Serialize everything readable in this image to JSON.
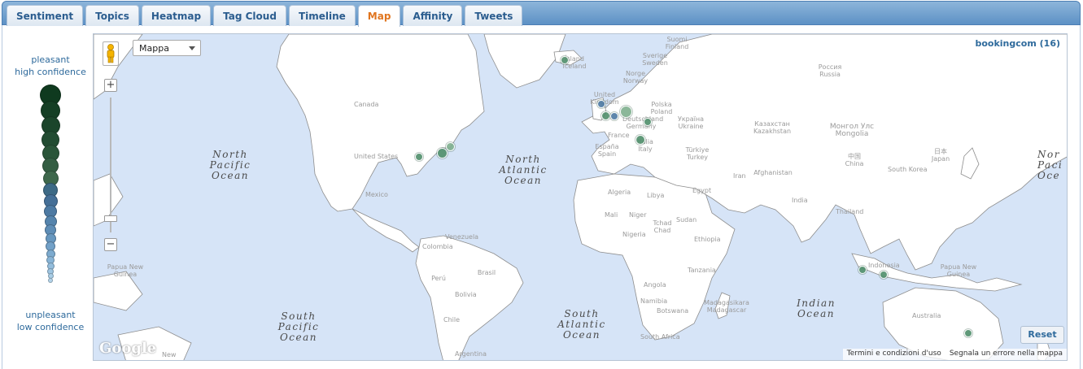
{
  "tabs": [
    {
      "label": "Sentiment",
      "active": false
    },
    {
      "label": "Topics",
      "active": false
    },
    {
      "label": "Heatmap",
      "active": false
    },
    {
      "label": "Tag Cloud",
      "active": false
    },
    {
      "label": "Timeline",
      "active": false
    },
    {
      "label": "Map",
      "active": true
    },
    {
      "label": "Affinity",
      "active": false
    },
    {
      "label": "Tweets",
      "active": false
    }
  ],
  "legend": {
    "top_line1": "pleasant",
    "top_line2": "high confidence",
    "bottom_line1": "unpleasant",
    "bottom_line2": "low confidence"
  },
  "map": {
    "type_selector": "Mappa",
    "query_label": "bookingcom (16)",
    "reset_label": "Reset",
    "logo": "Google",
    "footer_terms": "Termini e condizioni d'uso",
    "footer_report": "Segnala un errore nella mappa",
    "oceans": {
      "north_pacific": [
        "North",
        "Pacific",
        "Ocean"
      ],
      "north_atlantic": [
        "North",
        "Atlantic",
        "Ocean"
      ],
      "south_pacific": [
        "South",
        "Pacific",
        "Ocean"
      ],
      "south_atlantic": [
        "South",
        "Atlantic",
        "Ocean"
      ],
      "indian": [
        "Indian",
        "Ocean"
      ],
      "north_pacific_right": [
        "Nor",
        "Paci",
        "Oce"
      ]
    },
    "countries": {
      "canada": "Canada",
      "united_states": "United States",
      "mexico": "Mexico",
      "venezuela": "Venezuela",
      "colombia": "Colombia",
      "brasil": "Brasil",
      "peru": "Perú",
      "bolivia": "Bolivia",
      "chile": "Chile",
      "argentina": "Argentina",
      "iceland": "Ísland Iceland",
      "norway": "Norge Norway",
      "sweden": "Sverige Sweden",
      "finland": "Suomi Finland",
      "uk": "United Kingdom",
      "poland": "Polska Poland",
      "germany": "Deutschland Germany",
      "france": "France",
      "spain": "España Spain",
      "italy": "Italia Italy",
      "ukraine": "Україна Ukraine",
      "turkey": "Türkiye Turkey",
      "russia": "Россия Russia",
      "kazakhstan": "Казахстан Kazakhstan",
      "mongolia": "Монгол Улс Mongolia",
      "china": "中国 China",
      "japan": "日本 Japan",
      "south_korea": "South Korea",
      "afghanistan": "Afghanistan",
      "iran": "Iran",
      "india": "India",
      "thailand": "Thailand",
      "algeria": "Algeria",
      "libya": "Libya",
      "egypt": "Egypt",
      "mali": "Mali",
      "niger": "Niger",
      "chad": "Tchad Chad",
      "sudan": "Sudan",
      "nigeria": "Nigeria",
      "ethiopia": "Ethiopia",
      "tanzania": "Tanzania",
      "angola": "Angola",
      "namibia": "Namibia",
      "botswana": "Botswana",
      "madagascar": "Madagasikara Madagascar",
      "south_africa": "South Africa",
      "indonesia": "Indonesia",
      "papua_new_guinea": "Papua New Guinea",
      "australia": "Australia",
      "new": "New"
    }
  }
}
